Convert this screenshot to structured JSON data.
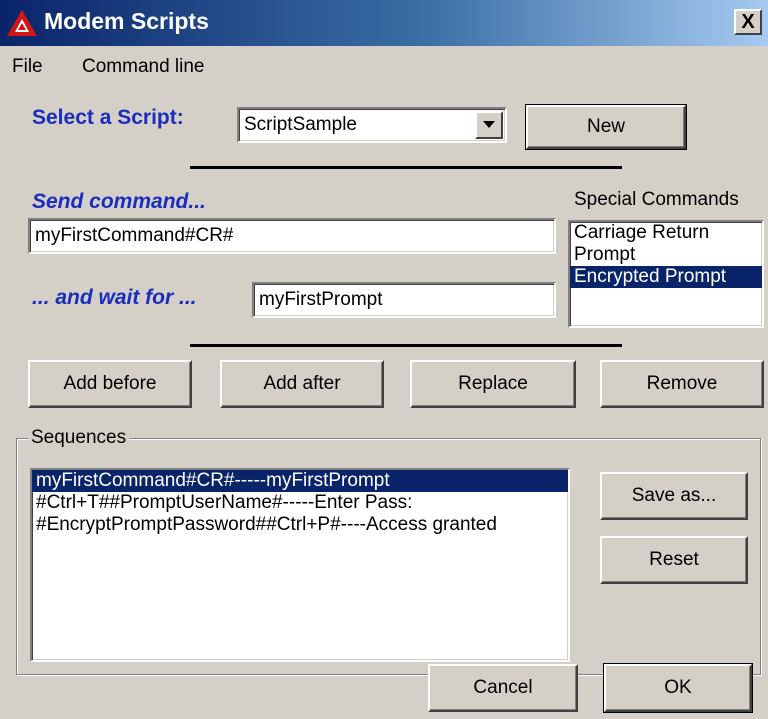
{
  "window": {
    "title": "Modem Scripts",
    "close_glyph": "X",
    "accent": "#0a246a"
  },
  "menu": {
    "items": [
      "File",
      "Command line"
    ]
  },
  "script_select": {
    "label": "Select a Script:",
    "value": "ScriptSample",
    "new_label": "New"
  },
  "send": {
    "label": "Send command...",
    "value": "myFirstCommand#CR#"
  },
  "wait": {
    "label": "... and wait for ...",
    "value": "myFirstPrompt"
  },
  "special": {
    "label": "Special Commands",
    "items": [
      "Carriage Return",
      "Prompt",
      "Encrypted Prompt"
    ],
    "selected_index": 2
  },
  "actions": {
    "add_before": "Add before",
    "add_after": "Add after",
    "replace": "Replace",
    "remove": "Remove"
  },
  "sequences": {
    "label": "Sequences",
    "items": [
      "myFirstCommand#CR#-----myFirstPrompt",
      "#Ctrl+T##PromptUserName#-----Enter Pass:",
      "#EncryptPromptPassword##Ctrl+P#----Access granted"
    ],
    "selected_index": 0,
    "save_as": "Save as...",
    "reset": "Reset"
  },
  "footer": {
    "cancel": "Cancel",
    "ok": "OK"
  }
}
